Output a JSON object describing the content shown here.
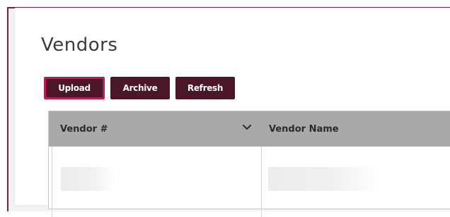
{
  "page": {
    "title": "Vendors"
  },
  "toolbar": {
    "upload_label": "Upload",
    "archive_label": "Archive",
    "refresh_label": "Refresh"
  },
  "grid": {
    "columns": [
      {
        "label": "Vendor #",
        "sort_icon": "chevron-down-icon"
      },
      {
        "label": "Vendor Name"
      }
    ]
  },
  "colors": {
    "brand": "#4a1628",
    "focus_outline": "#c0184f",
    "header_bg": "#a9a9a9",
    "frame_border": "#7b1f3c"
  }
}
